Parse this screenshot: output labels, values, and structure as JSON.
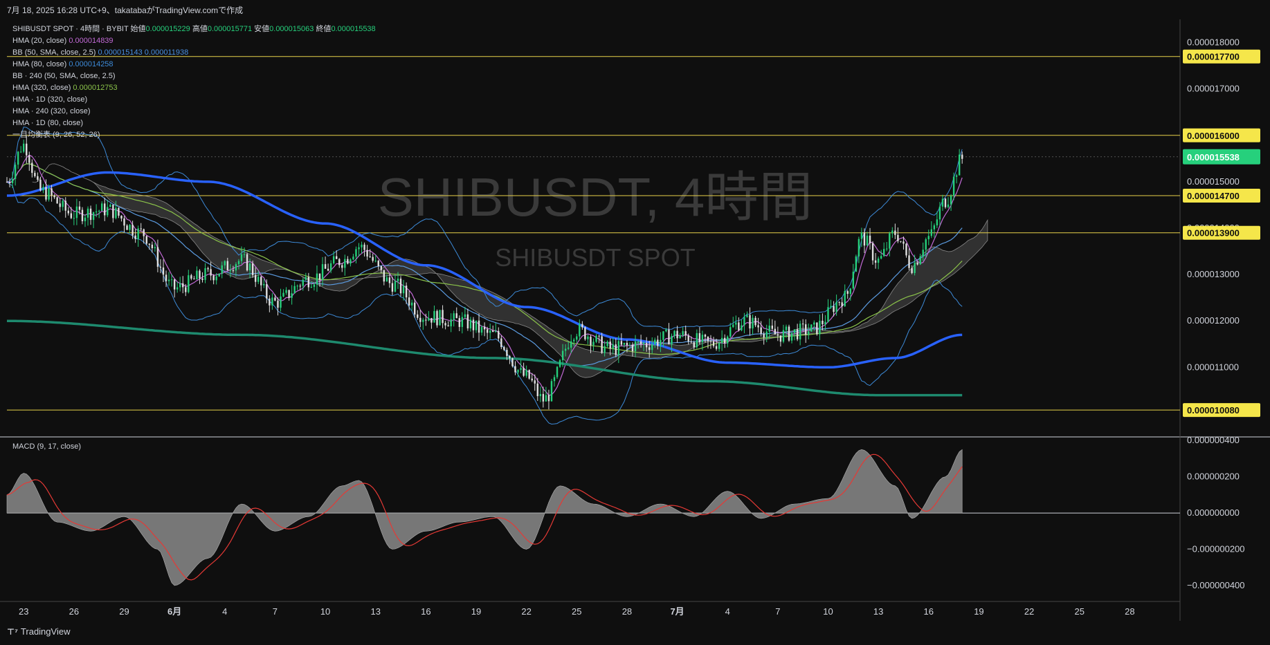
{
  "header": {
    "text": "7月 18, 2025 16:28 UTC+9、takatabaがTradingView.comで作成"
  },
  "legend": {
    "symbol_line": {
      "label": "SHIBUSDT SPOT · 4時間 · BYBIT",
      "open_label": "始値",
      "open": "0.000015229",
      "high_label": "高値",
      "high": "0.000015771",
      "low_label": "安値",
      "low": "0.000015063",
      "close_label": "終値",
      "close": "0.000015538"
    },
    "rows": [
      {
        "name": "HMA (20, close)",
        "value": "0.000014839",
        "color": "#c26ad6"
      },
      {
        "name": "BB (50, SMA, close, 2.5)",
        "value": "0.000015143  0.000011938",
        "color": "#4a90e2"
      },
      {
        "name": "HMA (80, close)",
        "value": "0.000014258",
        "color": "#3d8bd9"
      },
      {
        "name": "BB · 240 (50, SMA, close, 2.5)",
        "value": "",
        "color": "#d1d4dc"
      },
      {
        "name": "HMA (320, close)",
        "value": "0.000012753",
        "color": "#8bc34a"
      },
      {
        "name": "HMA · 1D (320, close)",
        "value": "",
        "color": "#d1d4dc"
      },
      {
        "name": "HMA · 240 (320, close)",
        "value": "",
        "color": "#d1d4dc"
      },
      {
        "name": "HMA · 1D (80, close)",
        "value": "",
        "color": "#d1d4dc"
      },
      {
        "name": "一目均衡表 (9, 26, 52, 26)",
        "value": "",
        "color": "#d1d4dc"
      }
    ]
  },
  "watermark": {
    "main": "SHIBUSDT, 4時間",
    "sub": "SHIBUSDT SPOT"
  },
  "macd": {
    "label": "MACD (9, 17, close)"
  },
  "footer": {
    "brand": "TradingView"
  },
  "colors": {
    "up": "#26d07c",
    "down": "#e0e0e0",
    "hline": "#e8d24a",
    "price_tag": "#26d07c",
    "hma_blue": "#2962ff",
    "hma_teal": "#1e8a6e",
    "hma20": "#c26ad6",
    "bb": "#3d8bd9",
    "hma320": "#8bc34a",
    "macd_hist": "#8a8a8a",
    "signal": "#e53935"
  },
  "chart_data": [
    {
      "type": "candlestick",
      "title": "SHIBUSDT, 4時間",
      "x_ticks": [
        "23",
        "26",
        "29",
        "6月",
        "4",
        "7",
        "10",
        "13",
        "16",
        "19",
        "22",
        "25",
        "28",
        "7月",
        "4",
        "7",
        "10",
        "13",
        "16",
        "19",
        "22",
        "25",
        "28"
      ],
      "y_ticks": [
        "0.000018000",
        "0.000017000",
        "0.000016000",
        "0.000015000",
        "0.000014000",
        "0.000013000",
        "0.000012000",
        "0.000011000"
      ],
      "ylim": [
        9.5e-06,
        1.85e-05
      ],
      "x_range_days": [
        "2025-05-22",
        "2025-07-31"
      ],
      "current_price": "0.000015538",
      "horizontal_levels": [
        "0.000017700",
        "0.000016000",
        "0.000014700",
        "0.000013900",
        "0.000010080"
      ],
      "close_path": [
        {
          "date": "2025-05-22",
          "close": 1.5e-05
        },
        {
          "date": "2025-05-23",
          "close": 1.58e-05
        },
        {
          "date": "2025-05-24",
          "close": 1.48e-05
        },
        {
          "date": "2025-05-26",
          "close": 1.43e-05
        },
        {
          "date": "2025-05-28",
          "close": 1.44e-05
        },
        {
          "date": "2025-05-30",
          "close": 1.39e-05
        },
        {
          "date": "2025-06-01",
          "close": 1.27e-05
        },
        {
          "date": "2025-06-03",
          "close": 1.3e-05
        },
        {
          "date": "2025-06-05",
          "close": 1.33e-05
        },
        {
          "date": "2025-06-07",
          "close": 1.24e-05
        },
        {
          "date": "2025-06-09",
          "close": 1.29e-05
        },
        {
          "date": "2025-06-11",
          "close": 1.33e-05
        },
        {
          "date": "2025-06-12",
          "close": 1.36e-05
        },
        {
          "date": "2025-06-14",
          "close": 1.28e-05
        },
        {
          "date": "2025-06-16",
          "close": 1.21e-05
        },
        {
          "date": "2025-06-18",
          "close": 1.2e-05
        },
        {
          "date": "2025-06-20",
          "close": 1.17e-05
        },
        {
          "date": "2025-06-22",
          "close": 1.08e-05
        },
        {
          "date": "2025-06-23",
          "close": 1.03e-05
        },
        {
          "date": "2025-06-25",
          "close": 1.18e-05
        },
        {
          "date": "2025-06-27",
          "close": 1.14e-05
        },
        {
          "date": "2025-06-29",
          "close": 1.15e-05
        },
        {
          "date": "2025-07-01",
          "close": 1.17e-05
        },
        {
          "date": "2025-07-03",
          "close": 1.15e-05
        },
        {
          "date": "2025-07-05",
          "close": 1.2e-05
        },
        {
          "date": "2025-07-07",
          "close": 1.17e-05
        },
        {
          "date": "2025-07-09",
          "close": 1.18e-05
        },
        {
          "date": "2025-07-11",
          "close": 1.25e-05
        },
        {
          "date": "2025-07-12",
          "close": 1.38e-05
        },
        {
          "date": "2025-07-13",
          "close": 1.33e-05
        },
        {
          "date": "2025-07-14",
          "close": 1.39e-05
        },
        {
          "date": "2025-07-15",
          "close": 1.32e-05
        },
        {
          "date": "2025-07-16",
          "close": 1.38e-05
        },
        {
          "date": "2025-07-17",
          "close": 1.46e-05
        },
        {
          "date": "2025-07-18",
          "close": 1.55e-05
        }
      ],
      "hma_80_1d": [
        {
          "date": "2025-05-22",
          "value": 1.47e-05
        },
        {
          "date": "2025-05-28",
          "value": 1.52e-05
        },
        {
          "date": "2025-06-03",
          "value": 1.5e-05
        },
        {
          "date": "2025-06-10",
          "value": 1.41e-05
        },
        {
          "date": "2025-06-16",
          "value": 1.32e-05
        },
        {
          "date": "2025-06-22",
          "value": 1.23e-05
        },
        {
          "date": "2025-06-28",
          "value": 1.16e-05
        },
        {
          "date": "2025-07-04",
          "value": 1.11e-05
        },
        {
          "date": "2025-07-10",
          "value": 1.1e-05
        },
        {
          "date": "2025-07-14",
          "value": 1.12e-05
        },
        {
          "date": "2025-07-18",
          "value": 1.17e-05
        }
      ],
      "hma_320_1d": [
        {
          "date": "2025-05-22",
          "value": 1.2e-05
        },
        {
          "date": "2025-06-05",
          "value": 1.17e-05
        },
        {
          "date": "2025-06-20",
          "value": 1.12e-05
        },
        {
          "date": "2025-07-03",
          "value": 1.07e-05
        },
        {
          "date": "2025-07-13",
          "value": 1.04e-05
        },
        {
          "date": "2025-07-18",
          "value": 1.04e-05
        }
      ]
    },
    {
      "type": "bar",
      "title": "MACD (9, 17, close)",
      "y_ticks": [
        "0.000000400",
        "0.000000200",
        "0.000000000",
        "−0.000000200",
        "−0.000000400"
      ],
      "ylim": [
        -4.5e-07,
        4.2e-07
      ],
      "histogram": [
        {
          "date": "2025-05-22",
          "value": 1e-07
        },
        {
          "date": "2025-05-23",
          "value": 2.2e-07
        },
        {
          "date": "2025-05-25",
          "value": -5e-08
        },
        {
          "date": "2025-05-27",
          "value": -1e-07
        },
        {
          "date": "2025-05-29",
          "value": -2e-08
        },
        {
          "date": "2025-05-31",
          "value": -2e-07
        },
        {
          "date": "2025-06-01",
          "value": -4e-07
        },
        {
          "date": "2025-06-03",
          "value": -2.5e-07
        },
        {
          "date": "2025-06-05",
          "value": 5e-08
        },
        {
          "date": "2025-06-07",
          "value": -1e-07
        },
        {
          "date": "2025-06-09",
          "value": -2e-08
        },
        {
          "date": "2025-06-11",
          "value": 1.5e-07
        },
        {
          "date": "2025-06-12",
          "value": 1.8e-07
        },
        {
          "date": "2025-06-14",
          "value": -2e-07
        },
        {
          "date": "2025-06-16",
          "value": -1e-07
        },
        {
          "date": "2025-06-18",
          "value": -5e-08
        },
        {
          "date": "2025-06-20",
          "value": -2e-08
        },
        {
          "date": "2025-06-22",
          "value": -2e-07
        },
        {
          "date": "2025-06-24",
          "value": 1.5e-07
        },
        {
          "date": "2025-06-26",
          "value": 5e-08
        },
        {
          "date": "2025-06-28",
          "value": -2e-08
        },
        {
          "date": "2025-06-30",
          "value": 5e-08
        },
        {
          "date": "2025-07-02",
          "value": -2e-08
        },
        {
          "date": "2025-07-04",
          "value": 1.2e-07
        },
        {
          "date": "2025-07-06",
          "value": -3e-08
        },
        {
          "date": "2025-07-08",
          "value": 5e-08
        },
        {
          "date": "2025-07-10",
          "value": 8e-08
        },
        {
          "date": "2025-07-12",
          "value": 3.5e-07
        },
        {
          "date": "2025-07-14",
          "value": 1.5e-07
        },
        {
          "date": "2025-07-15",
          "value": -3e-08
        },
        {
          "date": "2025-07-17",
          "value": 2e-07
        },
        {
          "date": "2025-07-18",
          "value": 3.5e-07
        }
      ]
    }
  ]
}
